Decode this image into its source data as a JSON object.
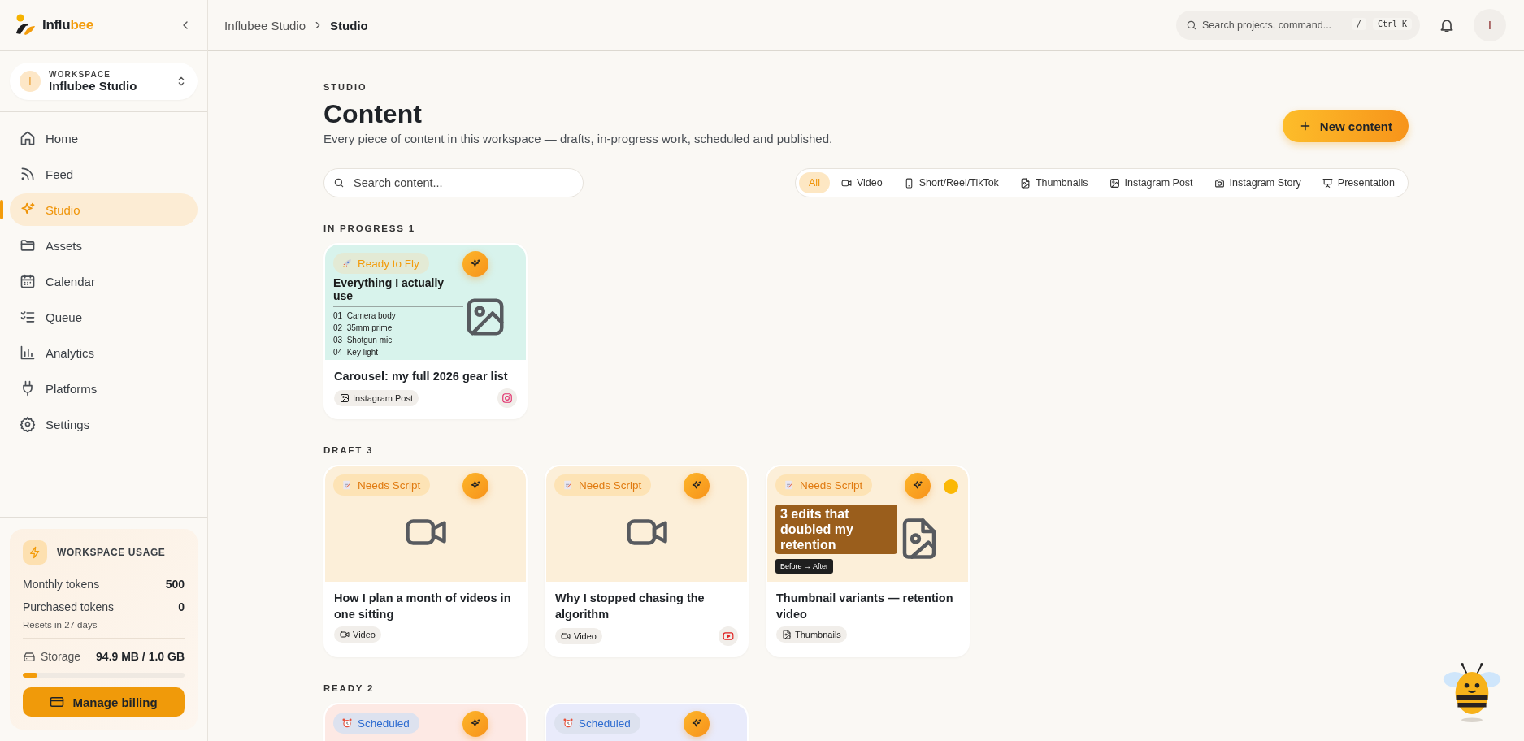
{
  "brand": {
    "name_start": "Influ",
    "name_end": "bee"
  },
  "sidebar": {
    "workspace": {
      "avatar": "I",
      "label": "WORKSPACE",
      "name": "Influbee Studio"
    },
    "items": [
      {
        "kind": "home",
        "label": "Home",
        "selected": false
      },
      {
        "kind": "feed",
        "label": "Feed",
        "selected": false
      },
      {
        "kind": "studio",
        "label": "Studio",
        "selected": true
      },
      {
        "kind": "assets",
        "label": "Assets",
        "selected": false
      },
      {
        "kind": "calendar",
        "label": "Calendar",
        "selected": false
      },
      {
        "kind": "queue",
        "label": "Queue",
        "selected": false
      },
      {
        "kind": "analytics",
        "label": "Analytics",
        "selected": false
      },
      {
        "kind": "platforms",
        "label": "Platforms",
        "selected": false
      },
      {
        "kind": "settings",
        "label": "Settings",
        "selected": false
      }
    ],
    "usage": {
      "title": "WORKSPACE USAGE",
      "rows": [
        {
          "label": "Monthly tokens",
          "value": "500"
        },
        {
          "label": "Purchased tokens",
          "value": "0"
        }
      ],
      "note": "Resets in 27 days",
      "storage": {
        "label": "Storage",
        "value": "94.9 MB / 1.0 GB",
        "level": 0.09
      },
      "button": "Manage billing"
    }
  },
  "header": {
    "breadcrumbs": [
      {
        "label": "Influbee Studio",
        "current": false
      },
      {
        "label": "Studio",
        "current": true
      }
    ],
    "search": {
      "placeholder": "Search projects, command...",
      "keys": [
        "/",
        "Ctrl K"
      ]
    },
    "avatar": "I"
  },
  "page": {
    "eyebrow": "STUDIO",
    "title": "Content",
    "subtitle": "Every piece of content in this workspace — drafts, in-progress work, scheduled and published.",
    "new_button": "New content",
    "search": {
      "placeholder": "Search content..."
    },
    "filters": [
      {
        "kind": "all",
        "label": "All",
        "selected": true
      },
      {
        "kind": "video",
        "label": "Video",
        "selected": false
      },
      {
        "kind": "short",
        "label": "Short/Reel/TikTok",
        "selected": false
      },
      {
        "kind": "thumbnails",
        "label": "Thumbnails",
        "selected": false
      },
      {
        "kind": "post",
        "label": "Instagram Post",
        "selected": false
      },
      {
        "kind": "story",
        "label": "Instagram Story",
        "selected": false
      },
      {
        "kind": "presentation",
        "label": "Presentation",
        "selected": false
      }
    ]
  },
  "sections": [
    {
      "title": "IN PROGRESS",
      "count": "1",
      "cards": [
        {
          "color": "#d8f3ec",
          "badge": {
            "kind": "ready",
            "label": "Ready to Fly"
          },
          "preview": {
            "kind": "list",
            "heading": "Everything I actually use",
            "items": [
              "01  Camera body",
              "02  35mm prime",
              "03  Shotgun mic",
              "04  Key light"
            ]
          },
          "title": "Carousel: my full 2026 gear list",
          "type": {
            "kind": "post",
            "label": "Instagram Post"
          },
          "platform": {
            "kind": "instagram"
          }
        }
      ]
    },
    {
      "title": "DRAFT",
      "count": "3",
      "cards": [
        {
          "color": "#fcefd9",
          "badge": {
            "kind": "draft",
            "label": "Needs Script"
          },
          "preview": {
            "kind": "video"
          },
          "title": "How I plan a month of videos in one sitting",
          "type": {
            "kind": "video",
            "label": "Video"
          }
        },
        {
          "color": "#fcefd9",
          "badge": {
            "kind": "draft",
            "label": "Needs Script"
          },
          "preview": {
            "kind": "video"
          },
          "title": "Why I stopped chasing the algorithm",
          "type": {
            "kind": "video",
            "label": "Video"
          },
          "platform": {
            "kind": "youtube"
          }
        },
        {
          "color": "#fcefd9",
          "badge": {
            "kind": "draft",
            "label": "Needs Script"
          },
          "preview": {
            "kind": "thumbnail",
            "heading": "3 edits that doubled my retention",
            "chip": "Before → After"
          },
          "status_dot": {
            "color": "#fbb805"
          },
          "title": "Thumbnail variants — retention video",
          "type": {
            "kind": "thumbnails",
            "label": "Thumbnails"
          }
        }
      ]
    },
    {
      "title": "READY",
      "count": "2",
      "cards": [
        {
          "color": "#fde9e4",
          "badge": {
            "kind": "scheduled",
            "label": "Scheduled"
          },
          "preview": {
            "kind": "blank"
          }
        },
        {
          "color": "#e9ebfb",
          "badge": {
            "kind": "scheduled",
            "label": "Scheduled"
          },
          "preview": {
            "kind": "blank"
          }
        }
      ]
    }
  ]
}
